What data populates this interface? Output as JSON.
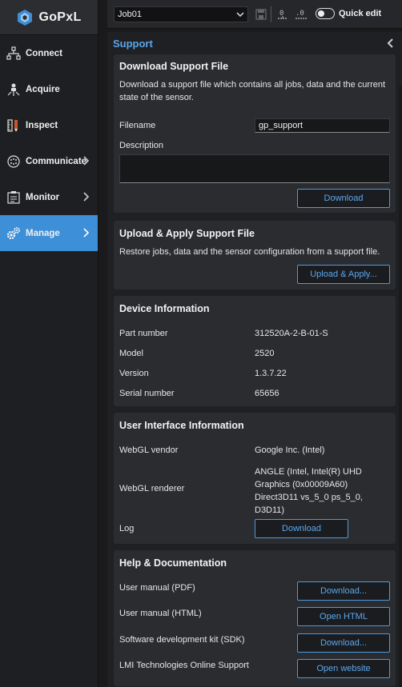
{
  "app": {
    "brand": "GoPxL"
  },
  "sidebar": {
    "items": [
      {
        "label": "Connect",
        "icon": "network-icon",
        "has_chevron": false
      },
      {
        "label": "Acquire",
        "icon": "acquire-icon",
        "has_chevron": false
      },
      {
        "label": "Inspect",
        "icon": "inspect-icon",
        "has_chevron": false
      },
      {
        "label": "Communicate",
        "icon": "communicate-icon",
        "has_chevron": true
      },
      {
        "label": "Monitor",
        "icon": "monitor-icon",
        "has_chevron": true
      },
      {
        "label": "Manage",
        "icon": "manage-icon",
        "has_chevron": true,
        "active": true
      }
    ]
  },
  "toolbar": {
    "job": "Job01",
    "quick_edit_label": "Quick edit"
  },
  "panel": {
    "title": "Support",
    "download_support": {
      "title": "Download Support File",
      "description": "Download a support file which contains all jobs, data and the current state of the sensor.",
      "filename_label": "Filename",
      "filename_value": "gp_support",
      "description_label": "Description",
      "description_value": "",
      "download_label": "Download"
    },
    "upload_support": {
      "title": "Upload & Apply Support File",
      "description": "Restore jobs, data and the sensor configuration from a support file.",
      "button_label": "Upload & Apply..."
    },
    "device_info": {
      "title": "Device Information",
      "rows": [
        {
          "label": "Part number",
          "value": "312520A-2-B-01-S"
        },
        {
          "label": "Model",
          "value": "2520"
        },
        {
          "label": "Version",
          "value": "1.3.7.22"
        },
        {
          "label": "Serial number",
          "value": "65656"
        }
      ]
    },
    "ui_info": {
      "title": "User Interface Information",
      "webgl_vendor_label": "WebGL vendor",
      "webgl_vendor_value": "Google Inc. (Intel)",
      "webgl_renderer_label": "WebGL renderer",
      "webgl_renderer_value": "ANGLE (Intel, Intel(R) UHD Graphics (0x00009A60) Direct3D11 vs_5_0 ps_5_0, D3D11)",
      "log_label": "Log",
      "log_button": "Download"
    },
    "help": {
      "title": "Help & Documentation",
      "rows": [
        {
          "label": "User manual (PDF)",
          "button": "Download..."
        },
        {
          "label": "User manual (HTML)",
          "button": "Open HTML"
        },
        {
          "label": "Software development kit (SDK)",
          "button": "Download..."
        },
        {
          "label": "LMI Technologies Online Support",
          "button": "Open website"
        }
      ]
    }
  },
  "colors": {
    "accent": "#3d8fd8",
    "link": "#5aa7ea",
    "card_bg": "#2b2c30",
    "panel_bg": "#1f2023"
  }
}
